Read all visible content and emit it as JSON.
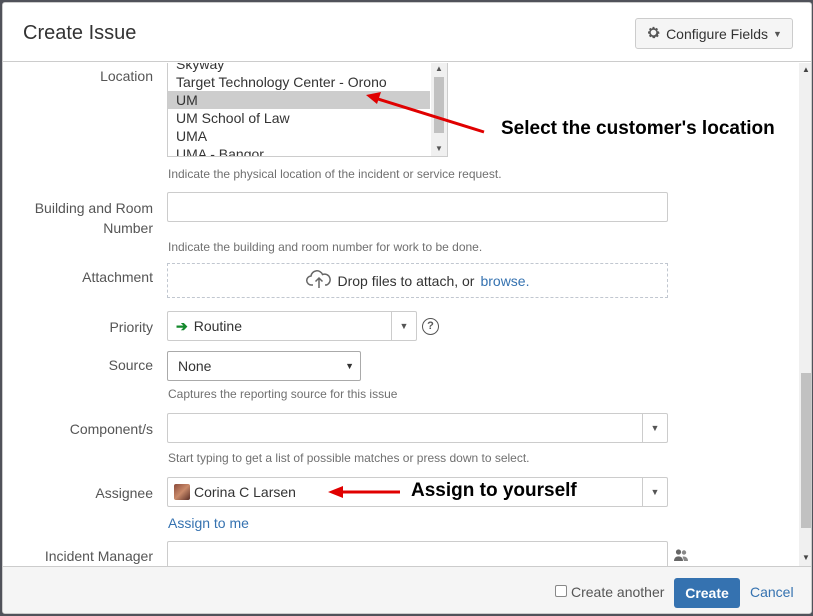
{
  "dialog": {
    "title": "Create Issue",
    "configure_fields": "Configure Fields"
  },
  "location": {
    "label": "Location",
    "options": [
      "Skyway",
      "Target Technology Center - Orono",
      "UM",
      "UM School of Law",
      "UMA",
      "UMA - Bangor"
    ],
    "selected": "UM",
    "help": "Indicate the physical location of the incident or service request."
  },
  "building": {
    "label_line1": "Building and Room",
    "label_line2": "Number",
    "value": "",
    "help": "Indicate the building and room number for work to be done."
  },
  "attachment": {
    "label": "Attachment",
    "drop_text": "Drop files to attach, or",
    "browse": "browse."
  },
  "priority": {
    "label": "Priority",
    "value": "Routine",
    "help_icon": "?"
  },
  "source": {
    "label": "Source",
    "value": "None",
    "help": "Captures the reporting source for this issue"
  },
  "components": {
    "label": "Component/s",
    "value": "",
    "help": "Start typing to get a list of possible matches or press down to select."
  },
  "assignee": {
    "label": "Assignee",
    "value": "Corina C Larsen",
    "assign_to_me": "Assign to me"
  },
  "incident_manager": {
    "label": "Incident Manager",
    "value": ""
  },
  "footer": {
    "create_another": "Create another",
    "create": "Create",
    "cancel": "Cancel"
  },
  "annotations": {
    "location_note": "Select the customer's location",
    "assignee_note": "Assign to yourself",
    "color": "#e00000"
  }
}
